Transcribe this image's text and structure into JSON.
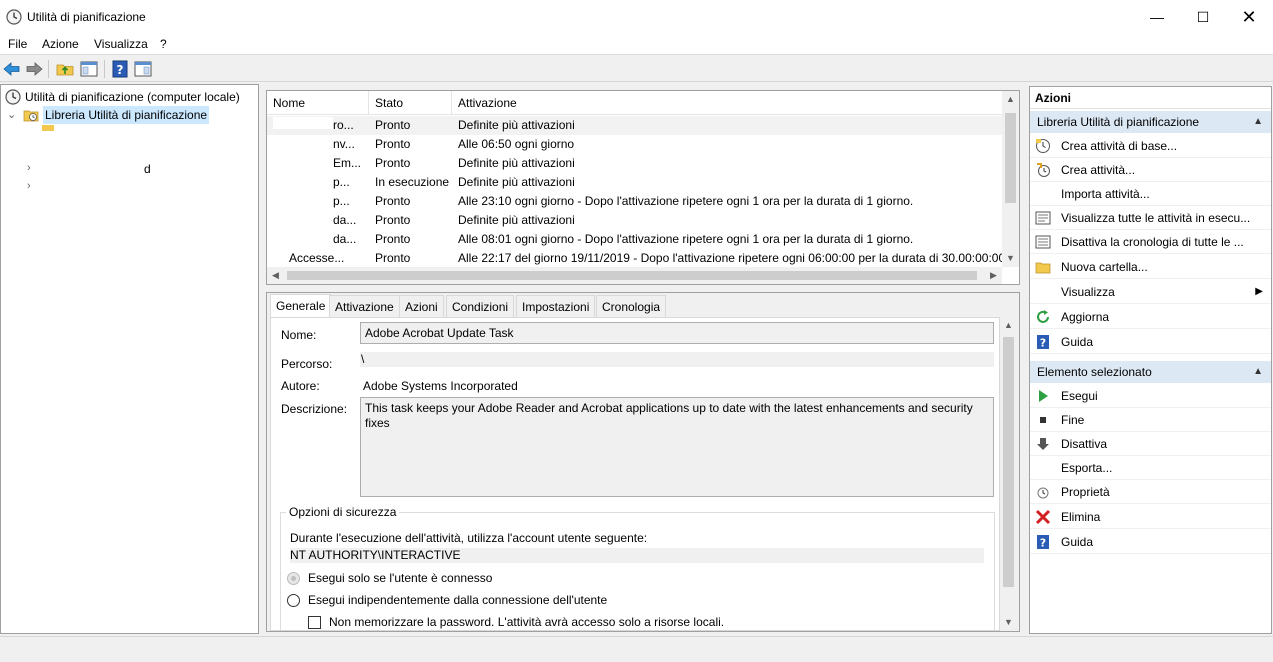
{
  "window": {
    "title": "Utilità di pianificazione",
    "minimize": "—",
    "maximize": "☐",
    "close": "✕"
  },
  "menu": [
    "File",
    "Azione",
    "Visualizza",
    "?"
  ],
  "tree": {
    "root": "Utilità di pianificazione (computer locale)",
    "library": "Libreria Utilità di pianificazione",
    "child_d": "d"
  },
  "task_list": {
    "columns": [
      "Nome",
      "Stato",
      "Attivazione"
    ],
    "rows": [
      {
        "name": "ro...",
        "status": "Pronto",
        "trigger": "Definite più attivazioni"
      },
      {
        "name": "nv...",
        "status": "Pronto",
        "trigger": "Alle 06:50 ogni giorno"
      },
      {
        "name": "Em...",
        "status": "Pronto",
        "trigger": "Definite più attivazioni"
      },
      {
        "name": "p...",
        "status": "In esecuzione",
        "trigger": "Definite più attivazioni"
      },
      {
        "name": "p...",
        "status": "Pronto",
        "trigger": "Alle 23:10 ogni giorno - Dopo l'attivazione ripetere ogni 1 ora per la durata di 1 giorno."
      },
      {
        "name": "da...",
        "status": "Pronto",
        "trigger": "Definite più attivazioni"
      },
      {
        "name": "da...",
        "status": "Pronto",
        "trigger": "Alle 08:01 ogni giorno - Dopo l'attivazione ripetere ogni 1 ora per la durata di 1 giorno."
      },
      {
        "name": "Accesse...",
        "status": "Pronto",
        "trigger": "Alle 22:17 del giorno 19/11/2019 - Dopo l'attivazione ripetere ogni 06:00:00 per la durata di 30.00:00:00."
      }
    ]
  },
  "tabs": [
    "Generale",
    "Attivazione",
    "Azioni",
    "Condizioni",
    "Impostazioni",
    "Cronologia"
  ],
  "general": {
    "name_label": "Nome:",
    "name_value": "Adobe Acrobat Update Task",
    "path_label": "Percorso:",
    "path_value": "\\",
    "author_label": "Autore:",
    "author_value": "Adobe Systems Incorporated",
    "desc_label": "Descrizione:",
    "desc_value": "This task keeps your Adobe Reader and Acrobat applications up to date with the latest enhancements and security fixes",
    "security_title": "Opzioni di sicurezza",
    "account_prompt": "Durante l'esecuzione dell'attività, utilizza l'account utente seguente:",
    "account_value": "NT AUTHORITY\\INTERACTIVE",
    "radio_logged": "Esegui solo se l'utente è connesso",
    "radio_any": "Esegui indipendentemente dalla connessione dell'utente",
    "no_store_pwd": "Non memorizzare la password. L'attività avrà accesso solo a risorse locali."
  },
  "actions": {
    "header": "Azioni",
    "section_library": "Libreria Utilità di pianificazione",
    "library_items": [
      "Crea attività di base...",
      "Crea attività...",
      "Importa attività...",
      "Visualizza tutte le attività in esecu...",
      "Disattiva la cronologia di tutte le ...",
      "Nuova cartella...",
      "Visualizza",
      "Aggiorna",
      "Guida"
    ],
    "section_selected": "Elemento selezionato",
    "selected_items": [
      "Esegui",
      "Fine",
      "Disattiva",
      "Esporta...",
      "Proprietà",
      "Elimina",
      "Guida"
    ]
  },
  "colors": {
    "selection": "#cce8ff",
    "section_header": "#dde8f5",
    "help_blue": "#2a5bb5",
    "run_green": "#2ea043",
    "delete_red": "#d42020"
  }
}
